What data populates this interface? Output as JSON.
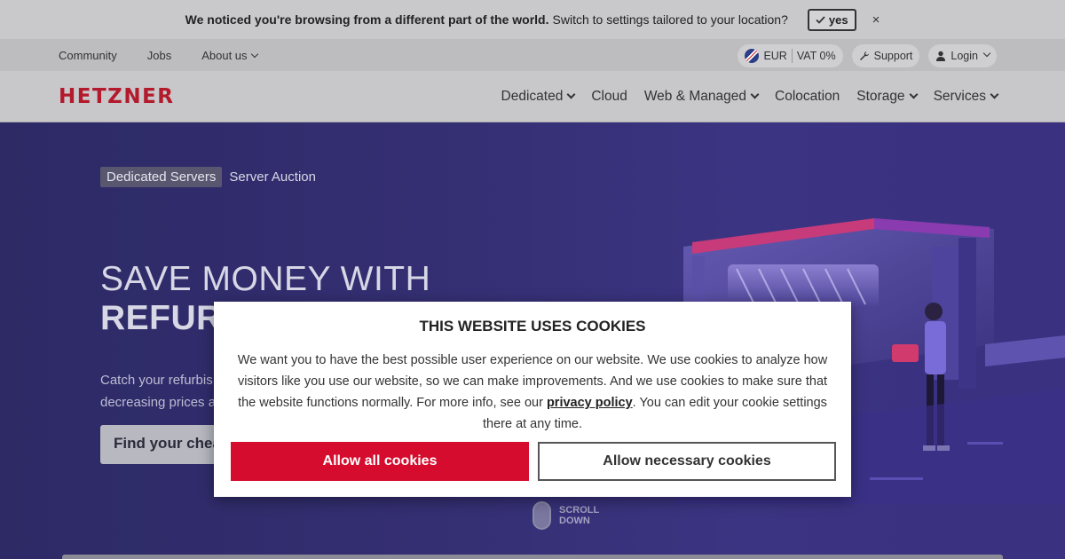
{
  "geo_banner": {
    "message_strong": "We noticed you're browsing from a different part of the world.",
    "message": "Switch to settings tailored to your location?",
    "yes_label": "yes",
    "close_symbol": "×"
  },
  "util_nav": {
    "links": [
      {
        "label": "Community"
      },
      {
        "label": "Jobs"
      },
      {
        "label": "About us"
      }
    ],
    "currency": "EUR",
    "vat": "VAT 0%",
    "support_label": "Support",
    "login_label": "Login"
  },
  "brand": {
    "logo_text": "HETZNER",
    "accent_color": "#d50c2d"
  },
  "main_nav": {
    "items": [
      {
        "label": "Dedicated",
        "has_dropdown": true
      },
      {
        "label": "Cloud",
        "has_dropdown": false
      },
      {
        "label": "Web & Managed",
        "has_dropdown": true
      },
      {
        "label": "Colocation",
        "has_dropdown": false
      },
      {
        "label": "Storage",
        "has_dropdown": true
      },
      {
        "label": "Services",
        "has_dropdown": true
      }
    ]
  },
  "hero": {
    "breadcrumbs": [
      "Dedicated Servers",
      "Server Auction"
    ],
    "title_line1": "SAVE MONEY WITH",
    "title_line2": "REFUR",
    "description_line1": "Catch your refurbis",
    "description_line2": "decreasing prices a",
    "cta_label": "Find your chea",
    "scroll_label_1": "SCROLL",
    "scroll_label_2": "DOWN"
  },
  "cookie_modal": {
    "title": "THIS WEBSITE USES COOKIES",
    "text_before_link": "We want you to have the best possible user experience on our website. We use cookies to analyze how visitors like you use our website, so we can make improvements. And we use cookies to make sure that the website functions normally. For more info, see our ",
    "link_text": "privacy policy",
    "text_after_link": ". You can edit your cookie settings there at any time.",
    "allow_all_label": "Allow all cookies",
    "allow_necessary_label": "Allow necessary cookies"
  }
}
